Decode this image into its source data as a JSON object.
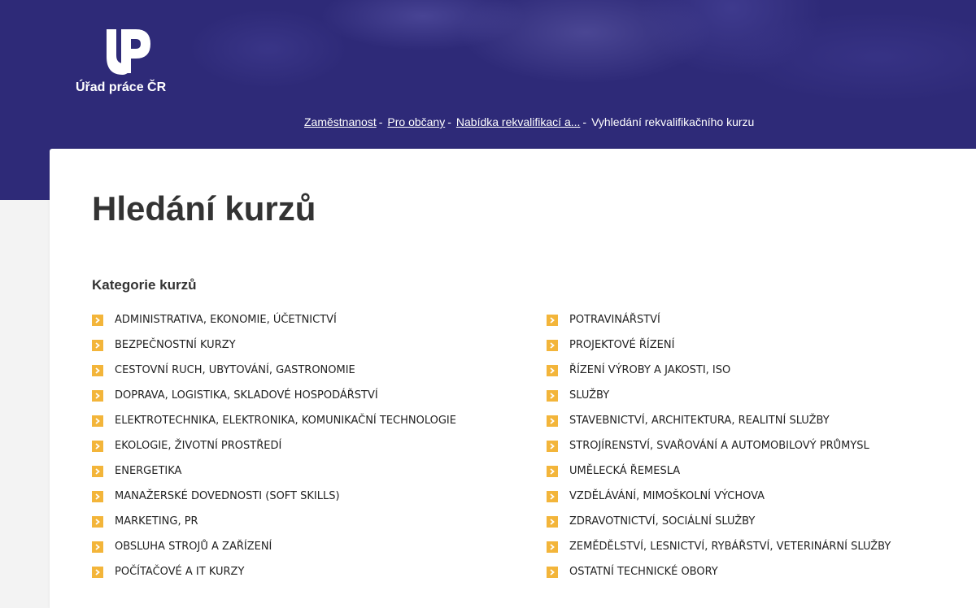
{
  "header": {
    "logo_text": "Úřad práce ČR",
    "breadcrumb": [
      {
        "label": "Zaměstnanost"
      },
      {
        "label": "Pro občany"
      },
      {
        "label": "Nabídka rekvalifikací a..."
      }
    ],
    "breadcrumb_separator": "-",
    "breadcrumb_current": "Vyhledání rekvalifikačního kurzu"
  },
  "main": {
    "title": "Hledání kurzů",
    "section_title": "Kategorie kurzů",
    "categories_left": [
      "ADMINISTRATIVA, EKONOMIE, ÚČETNICTVÍ",
      "BEZPEČNOSTNÍ KURZY",
      "CESTOVNÍ RUCH, UBYTOVÁNÍ, GASTRONOMIE",
      "DOPRAVA, LOGISTIKA, SKLADOVÉ HOSPODÁŘSTVÍ",
      "ELEKTROTECHNIKA, ELEKTRONIKA, KOMUNIKAČNÍ TECHNOLOGIE",
      "EKOLOGIE, ŽIVOTNÍ PROSTŘEDÍ",
      "ENERGETIKA",
      "MANAŽERSKÉ DOVEDNOSTI (SOFT SKILLS)",
      "MARKETING, PR",
      "OBSLUHA STROJŮ A ZAŘÍZENÍ",
      "POČÍTAČOVÉ A IT KURZY"
    ],
    "categories_right": [
      "POTRAVINÁŘSTVÍ",
      "PROJEKTOVÉ ŘÍZENÍ",
      "ŘÍZENÍ VÝROBY A JAKOSTI, ISO",
      "SLUŽBY",
      "STAVEBNICTVÍ, ARCHITEKTURA, REALITNÍ SLUŽBY",
      "STROJÍRENSTVÍ, SVAŘOVÁNÍ A AUTOMOBILOVÝ PRŮMYSL",
      "UMĚLECKÁ ŘEMESLA",
      "VZDĚLÁVÁNÍ, MIMOŠKOLNÍ VÝCHOVA",
      "ZDRAVOTNICTVÍ, SOCIÁLNÍ SLUŽBY",
      "ZEMĚDĚLSTVÍ, LESNICTVÍ, RYBÁŘSTVÍ, VETERINÁRNÍ SLUŽBY",
      "OSTATNÍ TECHNICKÉ OBORY"
    ]
  },
  "colors": {
    "header_bg": "#2e2a78",
    "accent": "#f3b53a",
    "text": "#222222"
  },
  "icons": {
    "logo": "up-logo-icon",
    "category_bullet": "chevron-right-icon"
  }
}
